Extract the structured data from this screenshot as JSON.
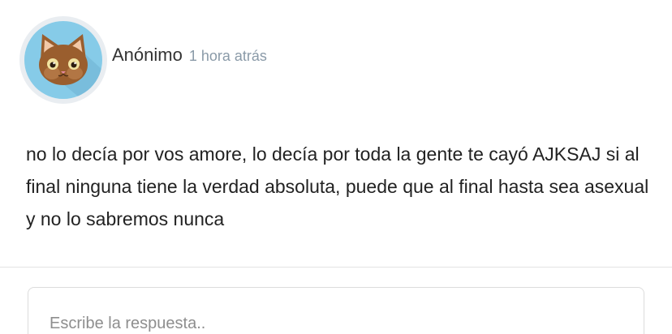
{
  "post": {
    "author": "Anónimo",
    "time": "1 hora atrás",
    "avatar_icon": "cat-face-icon",
    "body": "no lo decía por vos amore, lo decía por toda la gente te cayó AJKSAJ si al final ninguna tiene la verdad absoluta, puede que al final hasta sea asexual y no lo sabremos nunca"
  },
  "reply": {
    "placeholder": "Escribe la respuesta..",
    "value": ""
  },
  "colors": {
    "avatar_bg": "#86cbe8",
    "avatar_ring": "#e9edf1",
    "cat_fur": "#9a5e2e",
    "time_text": "#8a9aa8"
  }
}
